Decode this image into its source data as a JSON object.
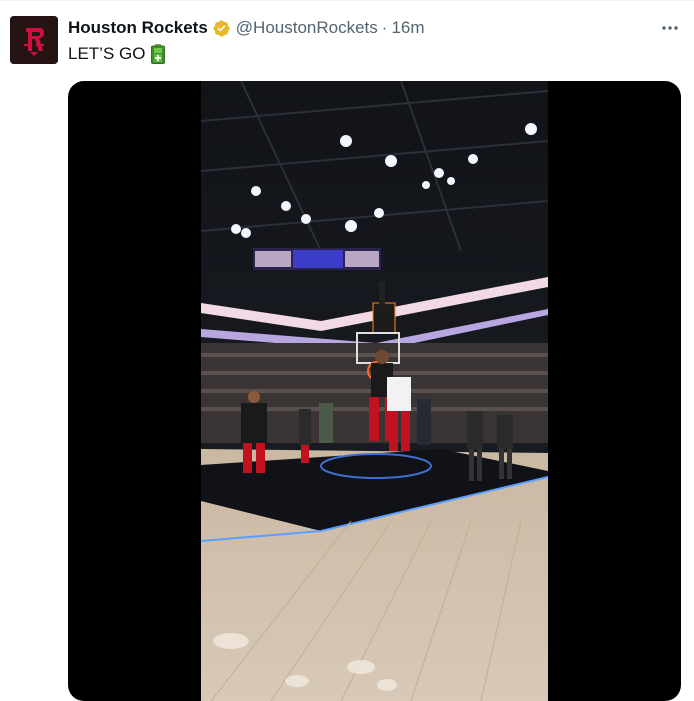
{
  "tweet": {
    "display_name": "Houston Rockets",
    "handle": "@HoustonRockets",
    "separator": "·",
    "time": "16m",
    "text": "LET’S GO"
  },
  "icons": {
    "avatar": "houston-rockets-logo",
    "verified": "verified-badge-icon",
    "more": "more-options-icon",
    "emoji": "battery-emoji-icon"
  },
  "colors": {
    "name": "#0f1419",
    "secondary": "#536471",
    "verified_gold": "#e8b829",
    "rockets_red": "#ce1141"
  }
}
